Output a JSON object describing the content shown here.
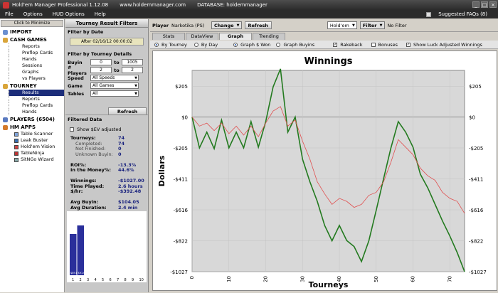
{
  "titlebar": {
    "title": "Hold'em Manager Professional 1.12.08",
    "website": "www.holdemmanager.com",
    "database": "DATABASE: holdemmanager"
  },
  "menu": [
    "File",
    "Options",
    "HUD Options",
    "Help"
  ],
  "faq": "Suggested FAQs (8)",
  "nav": {
    "minimize": "Click to Minimize",
    "import": "IMPORT",
    "cash_games": "CASH GAMES",
    "cash_items": [
      "Reports",
      "Preflop Cards",
      "Hands",
      "Sessions",
      "Graphs",
      "vs Players"
    ],
    "tourney": "TOURNEY",
    "tourney_items": [
      "Results",
      "Reports",
      "Preflop Cards",
      "Hands"
    ],
    "players": "PLAYERS (6504)",
    "hm_apps": "HM APPS",
    "apps": [
      "Table Scanner",
      "Leak Buster",
      "Hold'em Vision",
      "TableNinja",
      "SitNGo Wizard"
    ]
  },
  "filters": {
    "title": "Tourney Result Filters",
    "by_date": "Filter by Date",
    "date_btn": "After 02/16/12 00:00:02",
    "by_details": "Filter by Tourney Details",
    "buyin_label": "Buyin",
    "buyin_min": "0",
    "buyin_to": "to",
    "buyin_max": "1005",
    "players_label": "# Players",
    "players_min": "2",
    "players_to": "to",
    "players_max": "2",
    "speed_label": "Speed",
    "speed_val": "All Speeds",
    "game_label": "Game",
    "game_val": "All Games",
    "tables_label": "Tables",
    "tables_val": "All",
    "refresh": "Refresh"
  },
  "filtered": {
    "title": "Filtered Data",
    "sev": "Show $EV adjusted",
    "rows": [
      {
        "k": "Tourneys:",
        "v": "74",
        "dim": false
      },
      {
        "k": "Completed:",
        "v": "74",
        "dim": true
      },
      {
        "k": "Not Finished:",
        "v": "0",
        "dim": true
      },
      {
        "k": "Unknown Buyin:",
        "v": "0",
        "dim": true
      },
      {
        "k": "",
        "v": "",
        "dim": false
      },
      {
        "k": "ROI%:",
        "v": "-13.3%",
        "dim": false
      },
      {
        "k": "In the Money%:",
        "v": "44.6%",
        "dim": false
      },
      {
        "k": "",
        "v": "",
        "dim": false
      },
      {
        "k": "Winnings:",
        "v": "-$1027.00",
        "dim": false
      },
      {
        "k": "Time Played:",
        "v": "2.6 hours",
        "dim": false
      },
      {
        "k": "$/hr:",
        "v": "-$392.48",
        "dim": false
      },
      {
        "k": "",
        "v": "",
        "dim": false
      },
      {
        "k": "Avg Buyin:",
        "v": "$104.05",
        "dim": false
      },
      {
        "k": "Avg Duration:",
        "v": "2.4 min",
        "dim": false
      }
    ]
  },
  "minichart": {
    "bars": [
      {
        "x": "1",
        "value": "$89.8"
      },
      {
        "x": "2",
        "value": "$91.6"
      }
    ],
    "xlabels": [
      "1",
      "2",
      "3",
      "4",
      "5",
      "6",
      "7",
      "8",
      "9",
      "10"
    ],
    "bar_color": "#2a2f9b"
  },
  "main": {
    "player_label": "Player",
    "player_name": "Narkotika (PS)",
    "change": "Change",
    "refresh": "Refresh",
    "game": "Hold'em",
    "filter": "Filter",
    "no_filter": "No Filter"
  },
  "tabs": [
    "Stats",
    "DataView",
    "Graph",
    "Trending"
  ],
  "active_tab": "Graph",
  "options": {
    "by_tourney": "By Tourney",
    "by_day": "By Day",
    "graph_won": "Graph $ Won",
    "graph_buyins": "Graph Buyins",
    "rakeback": "Rakeback",
    "bonuses": "Bonuses",
    "luck": "Show Luck Adjusted Winnings"
  },
  "chart_data": {
    "type": "line",
    "title": "Winnings",
    "xlabel": "Tourneys",
    "ylabel": "Dollars",
    "xlim": [
      0,
      74
    ],
    "ylim": [
      -1027,
      310
    ],
    "yticks": [
      {
        "v": 205,
        "l": "$205"
      },
      {
        "v": 0,
        "l": "$0"
      },
      {
        "v": -205,
        "l": "-$205"
      },
      {
        "v": -411,
        "l": "-$411"
      },
      {
        "v": -616,
        "l": "-$616"
      },
      {
        "v": -822,
        "l": "-$822"
      },
      {
        "v": -1027,
        "l": "-$1027"
      }
    ],
    "xticks": [
      0,
      10,
      20,
      30,
      40,
      50,
      60,
      70
    ],
    "series": [
      {
        "color": "#237a1f",
        "width": 1.6,
        "x": [
          0,
          2,
          4,
          6,
          8,
          10,
          12,
          14,
          16,
          18,
          20,
          22,
          24,
          26,
          28,
          30,
          32,
          34,
          36,
          38,
          40,
          42,
          44,
          46,
          48,
          50,
          52,
          54,
          56,
          58,
          60,
          62,
          64,
          66,
          68,
          70,
          72,
          74
        ],
        "y": [
          0,
          -205,
          -100,
          -210,
          -20,
          -205,
          -100,
          -205,
          -30,
          -200,
          -30,
          200,
          320,
          -100,
          0,
          -280,
          -430,
          -560,
          -720,
          -822,
          -720,
          -820,
          -860,
          -960,
          -822,
          -620,
          -410,
          -205,
          -30,
          -100,
          -200,
          -380,
          -470,
          -580,
          -690,
          -790,
          -900,
          -1027
        ]
      },
      {
        "color": "#e05050",
        "width": 0.8,
        "x": [
          0,
          2,
          4,
          6,
          8,
          10,
          12,
          14,
          16,
          18,
          20,
          22,
          24,
          26,
          28,
          30,
          32,
          34,
          36,
          38,
          40,
          42,
          44,
          46,
          48,
          50,
          52,
          54,
          56,
          58,
          60,
          62,
          64,
          66,
          68,
          70,
          72,
          74
        ],
        "y": [
          0,
          -60,
          -40,
          -90,
          -40,
          -110,
          -60,
          -120,
          -60,
          -130,
          -40,
          40,
          70,
          -60,
          -20,
          -160,
          -280,
          -430,
          -510,
          -580,
          -540,
          -560,
          -600,
          -580,
          -520,
          -500,
          -430,
          -300,
          -150,
          -200,
          -250,
          -340,
          -390,
          -420,
          -500,
          -540,
          -560,
          -640
        ]
      }
    ]
  }
}
